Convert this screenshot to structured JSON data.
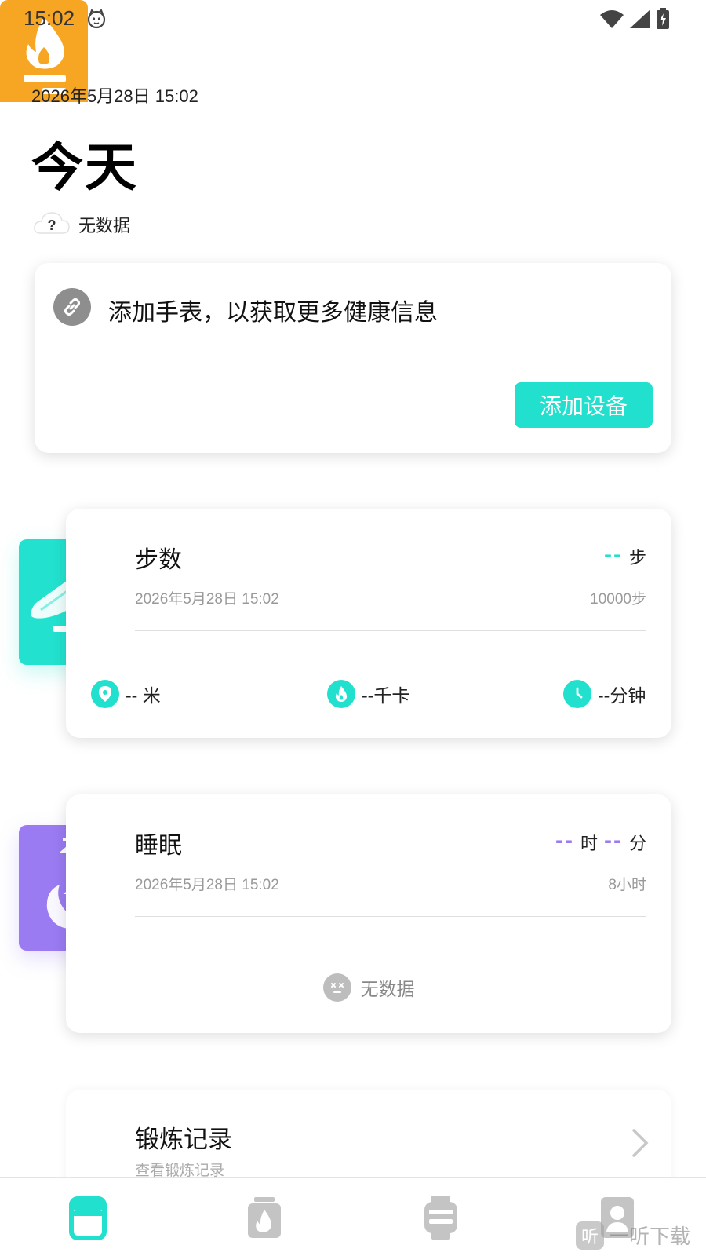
{
  "status_bar": {
    "time": "15:02"
  },
  "header": {
    "date": "2026年5月28日 15:02",
    "title": "今天",
    "weather_label": "无数据"
  },
  "device_card": {
    "prompt": "添加手表，以获取更多健康信息",
    "button_label": "添加设备"
  },
  "steps_card": {
    "title": "步数",
    "time": "2026年5月28日 15:02",
    "value": "--",
    "unit": "步",
    "goal": "10000步",
    "metrics": [
      {
        "icon": "location-pin-icon",
        "label": "-- 米"
      },
      {
        "icon": "flame-icon",
        "label": "--千卡"
      },
      {
        "icon": "clock-icon",
        "label": "--分钟"
      }
    ]
  },
  "sleep_card": {
    "title": "睡眠",
    "time": "2026年5月28日 15:02",
    "hours_value": "--",
    "hours_unit": "时",
    "minutes_value": "--",
    "minutes_unit": "分",
    "goal": "8小时",
    "no_data": "无数据"
  },
  "workout_card": {
    "title": "锻炼记录",
    "subtitle": "查看锻炼记录"
  },
  "bottom_nav": {
    "items": [
      {
        "icon": "home-dashboard-icon",
        "active": true
      },
      {
        "icon": "workout-icon",
        "active": false
      },
      {
        "icon": "watch-icon",
        "active": false
      },
      {
        "icon": "profile-icon",
        "active": false
      }
    ]
  },
  "watermark": {
    "logo": "听",
    "text": "一听下载"
  },
  "colors": {
    "accent": "#21e0ce",
    "sleep": "#9a7bf2",
    "workout": "#f7a623",
    "muted": "#999999"
  }
}
